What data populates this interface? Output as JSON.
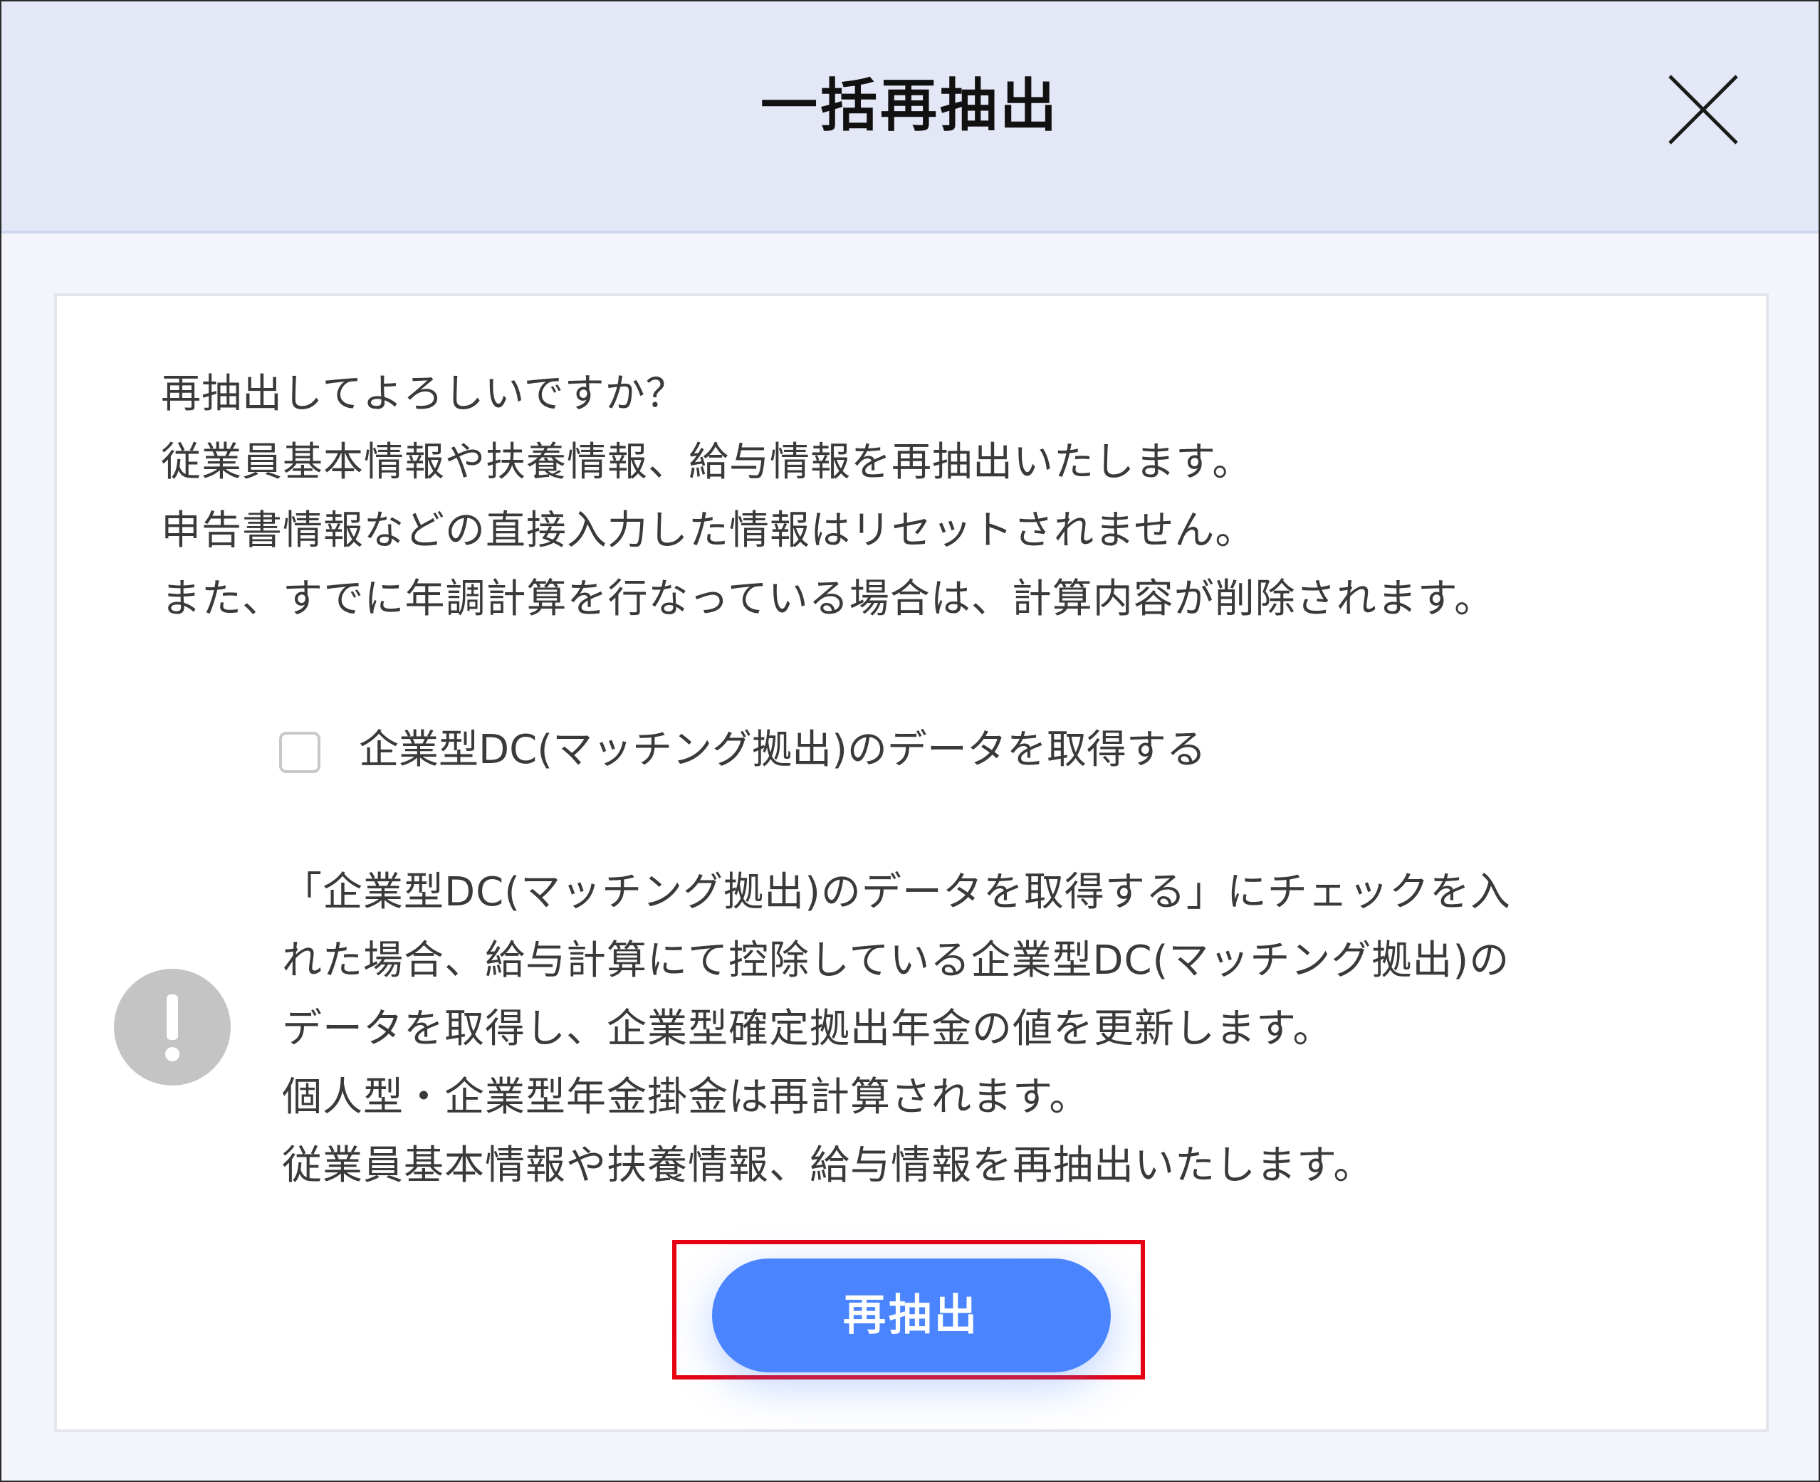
{
  "dialog": {
    "title": "一括再抽出",
    "close_icon": "close-icon"
  },
  "intro": {
    "lines": [
      "再抽出してよろしいですか？",
      "従業員基本情報や扶養情報、給与情報を再抽出いたします。",
      "申告書情報などの直接入力した情報はリセットされません。",
      "また、すでに年調計算を行なっている場合は、計算内容が削除されます。"
    ]
  },
  "option": {
    "checkbox_checked": false,
    "label": "企業型DC(マッチング拠出)のデータを取得する"
  },
  "notice": {
    "icon": "exclamation-circle-icon",
    "lines": [
      "「企業型DC(マッチング拠出)のデータを取得する」にチェックを入",
      "れた場合、給与計算にて控除している企業型DC(マッチング拠出)の",
      "データを取得し、企業型確定拠出年金の値を更新します。",
      "個人型・企業型年金掛金は再計算されます。",
      "従業員基本情報や扶養情報、給与情報を再抽出いたします。"
    ]
  },
  "actions": {
    "submit_label": "再抽出"
  },
  "colors": {
    "header_bg": "#e4e8f6",
    "primary_button": "#4a85ff",
    "highlight_border": "#e60012",
    "alert_icon": "#c4c4c4"
  }
}
